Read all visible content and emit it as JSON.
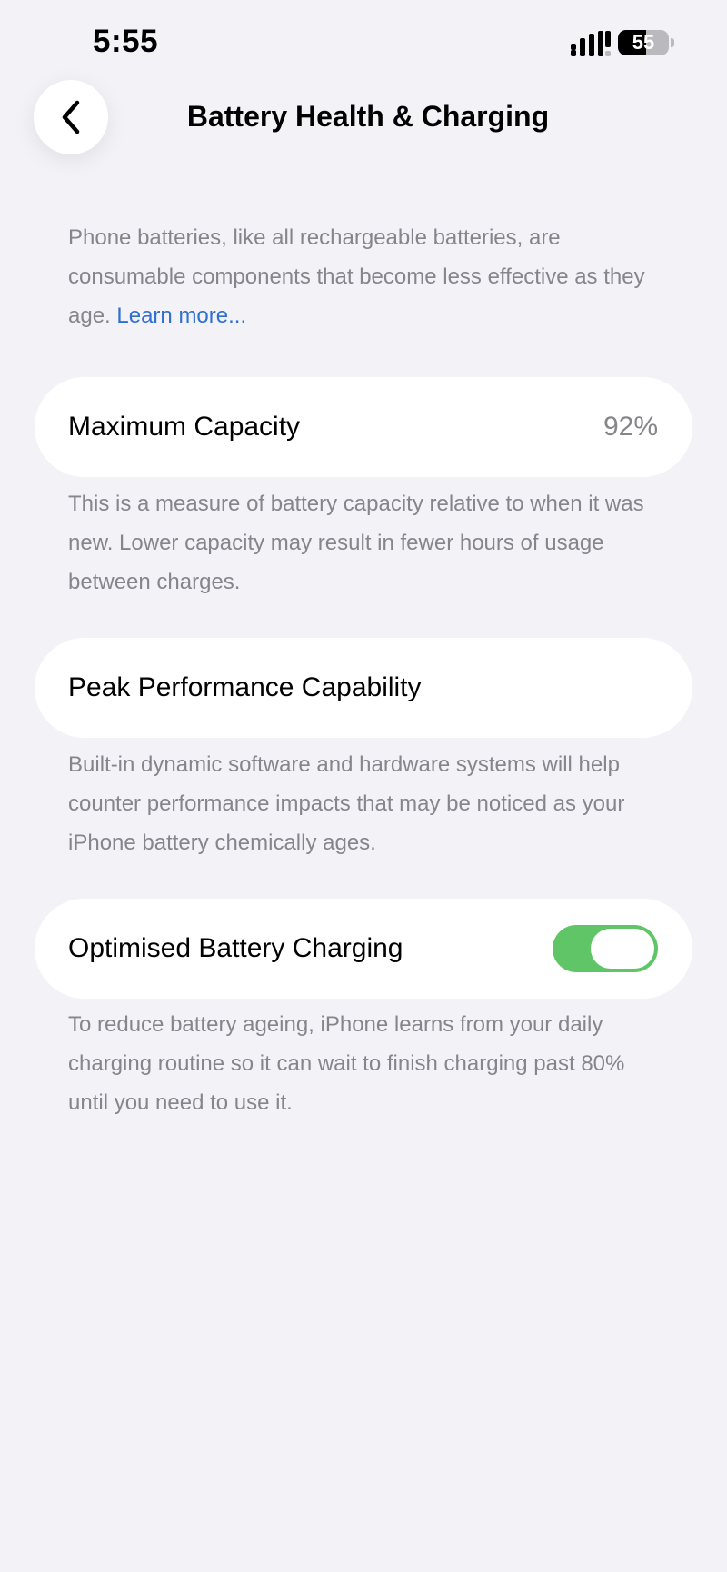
{
  "status_bar": {
    "time": "5:55",
    "battery_level": "55",
    "battery_fraction": 0.55,
    "signal_icon": "signal-bars-icon",
    "battery_icon": "battery-icon"
  },
  "nav": {
    "back_icon": "chevron-left-icon",
    "title": "Battery Health & Charging"
  },
  "intro": {
    "text": "Phone batteries, like all rechargeable batteries, are consumable components that become less effective as they age.",
    "link": "Learn more..."
  },
  "maximum_capacity": {
    "label": "Maximum Capacity",
    "value": "92%",
    "footer": "This is a measure of battery capacity relative to when it was new. Lower capacity may result in fewer hours of usage between charges."
  },
  "peak_performance": {
    "label": "Peak Performance Capability",
    "footer": "Built-in dynamic software and hardware systems will help counter performance impacts that may be noticed as your iPhone battery chemically ages."
  },
  "optimised_charging": {
    "label": "Optimised Battery Charging",
    "enabled": true,
    "footer": "To reduce battery ageing, iPhone learns from your daily charging routine so it can wait to finish charging past 80% until you need to use it."
  },
  "colors": {
    "background": "#f2f2f7",
    "card": "#ffffff",
    "secondary_text": "#85858b",
    "link": "#2f6fd1",
    "toggle_on": "#5fc566"
  }
}
